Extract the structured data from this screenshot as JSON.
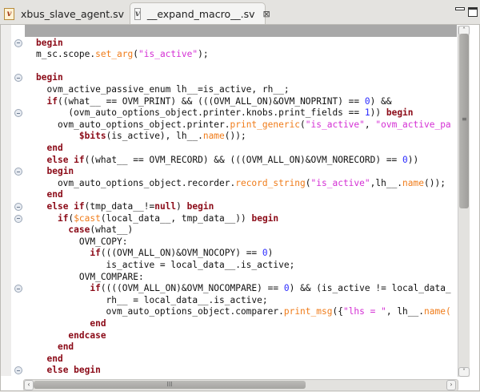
{
  "tabs": [
    {
      "label": "xbus_slave_agent.sv",
      "icon": "verilog-file-icon",
      "active": false
    },
    {
      "label": "__expand_macro__.sv",
      "icon": "verilog-file-icon",
      "active": true,
      "close": "⊠"
    }
  ],
  "colors": {
    "keyword": "#8b0a17",
    "method": "#f07c1a",
    "string": "#d42fd4",
    "number": "#2b2bff"
  },
  "code_lines": [
    {
      "fold": false,
      "highlight": true,
      "tokens": []
    },
    {
      "fold": true,
      "tokens": [
        [
          "kw",
          "begin"
        ]
      ]
    },
    {
      "fold": false,
      "tokens": [
        [
          "t",
          "m_sc.scope."
        ],
        [
          "fn",
          "set_arg"
        ],
        [
          "t",
          "("
        ],
        [
          "str",
          "\"is_active\""
        ],
        [
          "t",
          ");"
        ]
      ]
    },
    {
      "fold": false,
      "tokens": []
    },
    {
      "fold": true,
      "tokens": [
        [
          "kw",
          "begin"
        ]
      ]
    },
    {
      "fold": false,
      "tokens": [
        [
          "t",
          "  ovm_active_passive_enum lh__=is_active, rh__;"
        ]
      ]
    },
    {
      "fold": false,
      "tokens": [
        [
          "t",
          "  "
        ],
        [
          "kw",
          "if"
        ],
        [
          "t",
          "((what__ == OVM_PRINT) && (((OVM_ALL_ON)&OVM_NOPRINT) == "
        ],
        [
          "num",
          "0"
        ],
        [
          "t",
          ") &&"
        ]
      ]
    },
    {
      "fold": true,
      "tokens": [
        [
          "t",
          "      (ovm_auto_options_object.printer.knobs.print_fields == "
        ],
        [
          "num",
          "1"
        ],
        [
          "t",
          ")) "
        ],
        [
          "kw",
          "begin"
        ]
      ]
    },
    {
      "fold": false,
      "tokens": [
        [
          "t",
          "    ovm_auto_options_object.printer."
        ],
        [
          "fn",
          "print_generic"
        ],
        [
          "t",
          "("
        ],
        [
          "str",
          "\"is_active\""
        ],
        [
          "t",
          ", "
        ],
        [
          "str",
          "\"ovm_active_pa"
        ]
      ]
    },
    {
      "fold": false,
      "tokens": [
        [
          "t",
          "        "
        ],
        [
          "kw",
          "$bits"
        ],
        [
          "t",
          "(is_active), lh__."
        ],
        [
          "fn",
          "name"
        ],
        [
          "t",
          "());"
        ]
      ]
    },
    {
      "fold": false,
      "tokens": [
        [
          "t",
          "  "
        ],
        [
          "kw",
          "end"
        ]
      ]
    },
    {
      "fold": false,
      "tokens": [
        [
          "t",
          "  "
        ],
        [
          "kw",
          "else if"
        ],
        [
          "t",
          "((what__ == OVM_RECORD) && (((OVM_ALL_ON)&OVM_NORECORD) == "
        ],
        [
          "num",
          "0"
        ],
        [
          "t",
          "))"
        ]
      ]
    },
    {
      "fold": true,
      "tokens": [
        [
          "t",
          "  "
        ],
        [
          "kw",
          "begin"
        ]
      ]
    },
    {
      "fold": false,
      "tokens": [
        [
          "t",
          "    ovm_auto_options_object.recorder."
        ],
        [
          "fn",
          "record_string"
        ],
        [
          "t",
          "("
        ],
        [
          "str",
          "\"is_active\""
        ],
        [
          "t",
          ",lh__."
        ],
        [
          "fn",
          "name"
        ],
        [
          "t",
          "());"
        ]
      ]
    },
    {
      "fold": false,
      "tokens": [
        [
          "t",
          "  "
        ],
        [
          "kw",
          "end"
        ]
      ]
    },
    {
      "fold": true,
      "tokens": [
        [
          "t",
          "  "
        ],
        [
          "kw",
          "else if"
        ],
        [
          "t",
          "(tmp_data__!="
        ],
        [
          "kw",
          "null"
        ],
        [
          "t",
          ") "
        ],
        [
          "kw",
          "begin"
        ]
      ]
    },
    {
      "fold": true,
      "tokens": [
        [
          "t",
          "    "
        ],
        [
          "kw",
          "if"
        ],
        [
          "t",
          "("
        ],
        [
          "fn",
          "$cast"
        ],
        [
          "t",
          "(local_data__, tmp_data__)) "
        ],
        [
          "kw",
          "begin"
        ]
      ]
    },
    {
      "fold": false,
      "tokens": [
        [
          "t",
          "      "
        ],
        [
          "kw",
          "case"
        ],
        [
          "t",
          "(what__)"
        ]
      ]
    },
    {
      "fold": false,
      "tokens": [
        [
          "t",
          "        OVM_COPY:"
        ]
      ]
    },
    {
      "fold": false,
      "tokens": [
        [
          "t",
          "          "
        ],
        [
          "kw",
          "if"
        ],
        [
          "t",
          "(((OVM_ALL_ON)&OVM_NOCOPY) == "
        ],
        [
          "num",
          "0"
        ],
        [
          "t",
          ")"
        ]
      ]
    },
    {
      "fold": false,
      "tokens": [
        [
          "t",
          "             is_active = local_data__.is_active;"
        ]
      ]
    },
    {
      "fold": false,
      "tokens": [
        [
          "t",
          "        OVM_COMPARE:"
        ]
      ]
    },
    {
      "fold": true,
      "tokens": [
        [
          "t",
          "          "
        ],
        [
          "kw",
          "if"
        ],
        [
          "t",
          "((((OVM_ALL_ON)&OVM_NOCOMPARE) == "
        ],
        [
          "num",
          "0"
        ],
        [
          "t",
          ") && (is_active != local_data_"
        ]
      ]
    },
    {
      "fold": false,
      "tokens": [
        [
          "t",
          "             rh__ = local_data__.is_active;"
        ]
      ]
    },
    {
      "fold": false,
      "tokens": [
        [
          "t",
          "             ovm_auto_options_object.comparer."
        ],
        [
          "fn",
          "print_msg"
        ],
        [
          "t",
          "({"
        ],
        [
          "str",
          "\"lhs = \""
        ],
        [
          "t",
          ", lh__."
        ],
        [
          "fn",
          "name("
        ]
      ]
    },
    {
      "fold": false,
      "tokens": [
        [
          "t",
          "          "
        ],
        [
          "kw",
          "end"
        ]
      ]
    },
    {
      "fold": false,
      "tokens": [
        [
          "t",
          "      "
        ],
        [
          "kw",
          "endcase"
        ]
      ]
    },
    {
      "fold": false,
      "tokens": [
        [
          "t",
          "    "
        ],
        [
          "kw",
          "end"
        ]
      ]
    },
    {
      "fold": false,
      "tokens": [
        [
          "t",
          "  "
        ],
        [
          "kw",
          "end"
        ]
      ]
    },
    {
      "fold": true,
      "tokens": [
        [
          "t",
          "  "
        ],
        [
          "kw",
          "else begin"
        ]
      ]
    }
  ],
  "scrollbars": {
    "vertical_position": 0.0,
    "vertical_visible_fraction": 0.5,
    "horizontal_position": 0.0,
    "horizontal_visible_fraction": 0.63,
    "thumb_grip": "≡",
    "h_thumb_grip": "III"
  }
}
